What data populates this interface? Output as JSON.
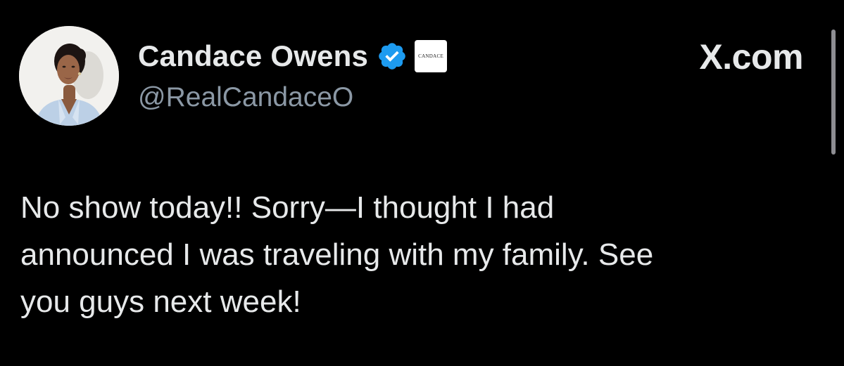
{
  "author": {
    "display_name": "Candace Owens",
    "handle": "@RealCandaceO",
    "verified_badge_icon": "verified-checkmark-icon",
    "verified_color": "#1d9bf0",
    "affiliate_badge_text": "CANDACE"
  },
  "brand": {
    "label": "X.com"
  },
  "tweet": {
    "text": "No show today!! Sorry—I thought I had\nannounced I was traveling with my family. See\nyou guys next week!"
  },
  "colors": {
    "background": "#000000",
    "primary_text": "#e7e9ea",
    "secondary_text": "#8b98a5"
  }
}
